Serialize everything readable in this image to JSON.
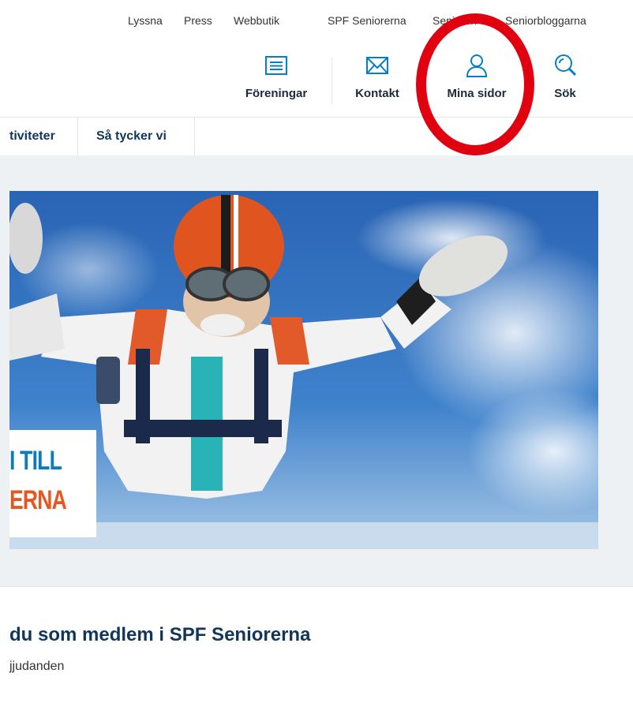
{
  "top_links": [
    "Lyssna",
    "Press",
    "Webbutik",
    "SPF Seniorerna",
    "Senioren",
    "Seniorbloggarna"
  ],
  "icon_nav": {
    "foreningar": "Föreningar",
    "kontakt": "Kontakt",
    "mina_sidor": "Mina sidor",
    "sok": "Sök"
  },
  "main_nav": [
    "tiviteter",
    "Så tycker vi"
  ],
  "hero": {
    "line1": "I TILL",
    "line2": "ERNA"
  },
  "content": {
    "heading": "du som medlem i SPF Seniorerna",
    "subtext": "jjudanden"
  },
  "colors": {
    "accent_blue": "#0a7cc2",
    "navy": "#12365a",
    "annotation_red": "#e1000f",
    "hero_orange": "#e8561f"
  }
}
